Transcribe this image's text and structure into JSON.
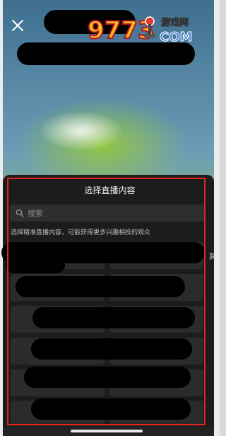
{
  "header": {
    "close_icon": "close-icon"
  },
  "watermark": {
    "logo_text": "9773",
    "site_cn": "游戏网",
    "site_en": "COM"
  },
  "sheet": {
    "title": "选择直播内容",
    "search": {
      "placeholder": "搜索",
      "icon": "search-icon"
    },
    "hint": "选择精准直播内容，可能获得更多兴趣相投的观众",
    "side_text": "其",
    "accent_color": "#e0241f"
  }
}
